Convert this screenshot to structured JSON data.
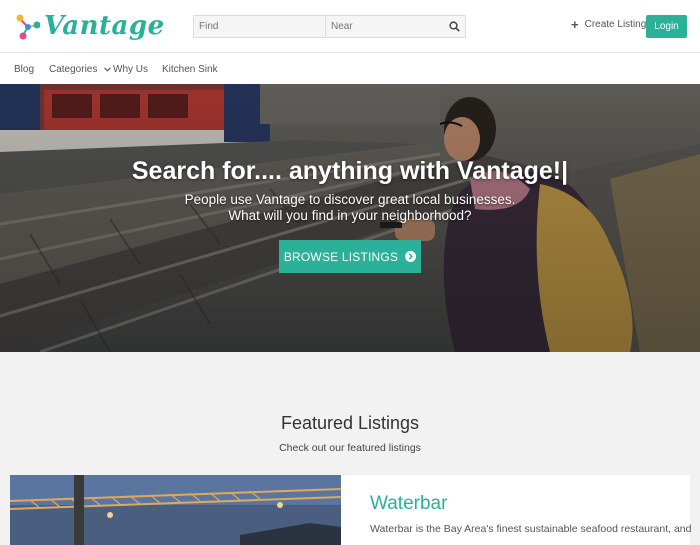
{
  "header": {
    "logo_text": "Vantage",
    "search": {
      "find_placeholder": "Find",
      "near_placeholder": "Near"
    },
    "create_label": "Create Listing",
    "login_label": "Login"
  },
  "nav": {
    "items": [
      "Blog",
      "Categories",
      "Why Us",
      "Kitchen Sink"
    ]
  },
  "hero": {
    "title": "Search for.... anything with Vantage!|",
    "line1": "People use Vantage to discover great local businesses.",
    "line2": "What will you find in your neighborhood?",
    "button_label": "BROWSE LISTINGS"
  },
  "featured": {
    "title": "Featured Listings",
    "subtitle": "Check out our featured listings",
    "listing": {
      "title": "Waterbar",
      "description": "Waterbar is the Bay Area's finest sustainable seafood restaurant, and"
    }
  },
  "colors": {
    "accent": "#2bb19a"
  },
  "icons": {
    "search": "search-icon",
    "plus": "plus-icon",
    "chevron": "chevron-down-icon",
    "arrow": "arrow-right-circle-icon"
  }
}
